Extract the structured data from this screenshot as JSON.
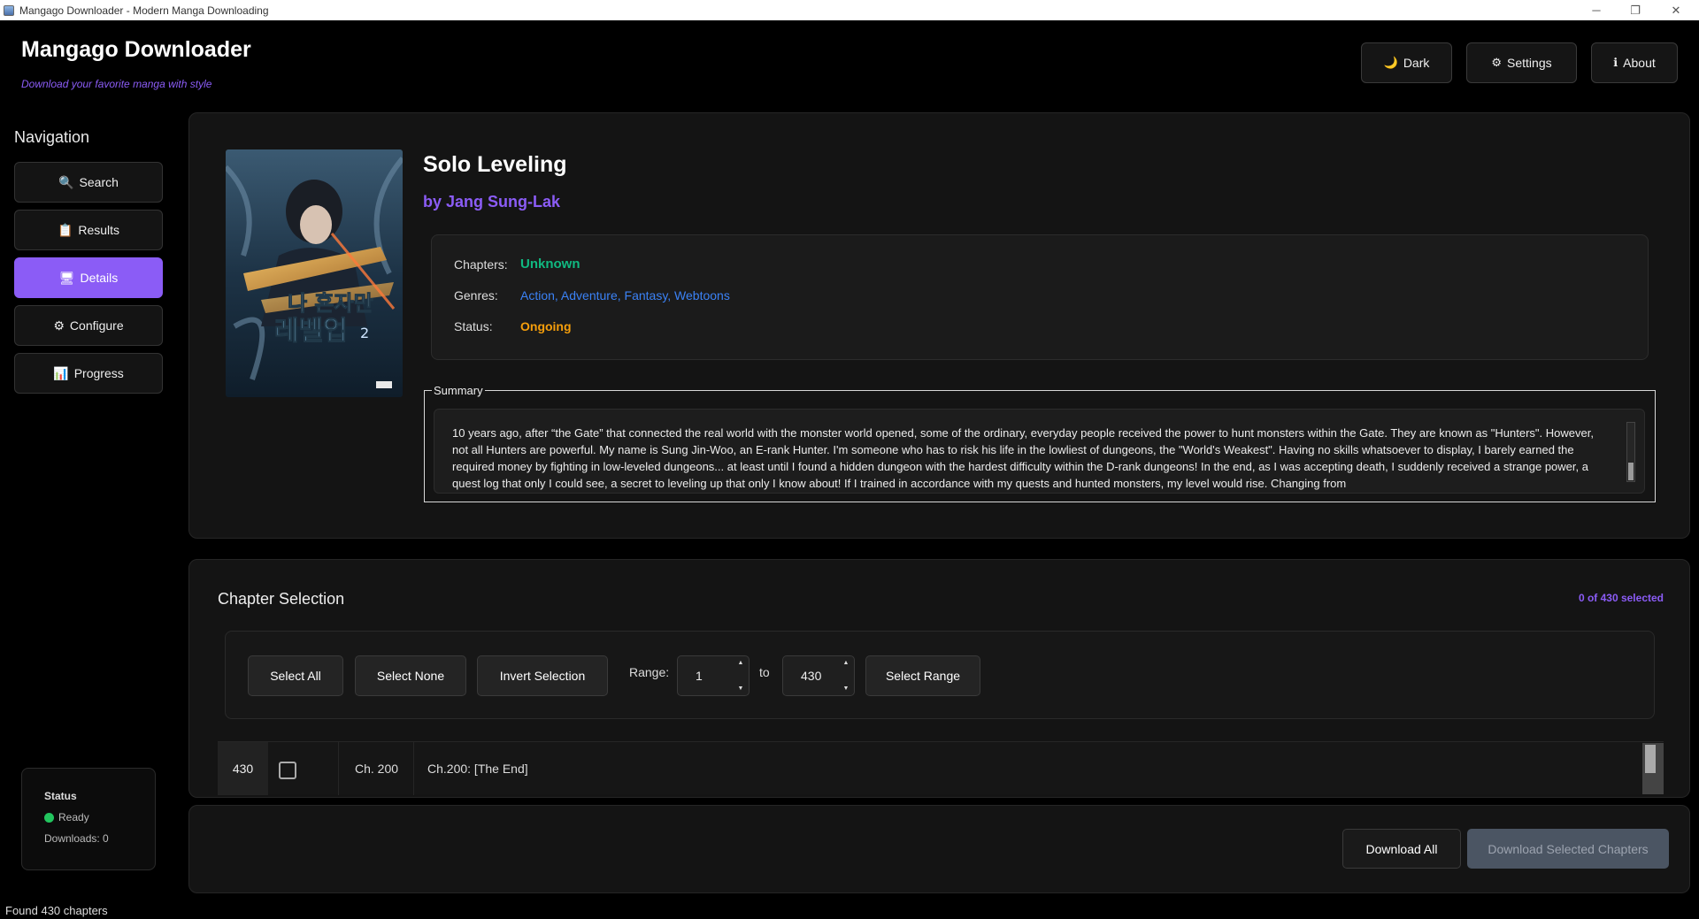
{
  "window": {
    "title": "Mangago Downloader - Modern Manga Downloading",
    "minimize": "─",
    "restore": "❐",
    "close": "✕"
  },
  "header": {
    "title": "Mangago Downloader",
    "subtitle": "Download your favorite manga with style",
    "buttons": [
      {
        "icon": "🌙",
        "label": "Dark"
      },
      {
        "icon": "⚙",
        "label": "Settings"
      },
      {
        "icon": "ℹ",
        "label": "About"
      }
    ]
  },
  "sidebar": {
    "title": "Navigation",
    "items": [
      {
        "icon": "🔍",
        "label": "Search"
      },
      {
        "icon": "📋",
        "label": "Results"
      },
      {
        "icon": "🖥",
        "label": "Details",
        "active": true
      },
      {
        "icon": "⚙",
        "label": "Configure"
      },
      {
        "icon": "📊",
        "label": "Progress"
      }
    ],
    "status": {
      "title": "Status",
      "state": "Ready",
      "downloads": "Downloads: 0"
    }
  },
  "details": {
    "cover_label": "나 혼자만 레벨업 2",
    "title": "Solo Leveling",
    "author": "by Jang Sung-Lak",
    "chapters_label": "Chapters:",
    "chapters_value": "Unknown",
    "genres_label": "Genres:",
    "genres_value": "Action, Adventure, Fantasy, Webtoons",
    "status_label": "Status:",
    "status_value": "Ongoing",
    "summary_legend": "Summary",
    "summary_text": "10 years ago, after “the Gate” that connected the real world with the monster world opened, some of the ordinary, everyday people received the power to hunt monsters within the Gate. They are known as \"Hunters\". However, not all Hunters are powerful. My name is Sung Jin-Woo, an E-rank Hunter. I'm someone who has to risk his life in the lowliest of dungeons, the \"World's Weakest\". Having no skills whatsoever to display, I barely earned the required money by fighting in low-leveled dungeons... at least until I found a hidden dungeon with the hardest difficulty within the D-rank dungeons! In the end, as I was accepting death, I suddenly received a strange power, a quest log that only I could see, a secret to leveling up that only I know about! If I trained in accordance with my quests and hunted monsters, my level would rise. Changing from"
  },
  "chapter_selection": {
    "title": "Chapter Selection",
    "selected_count": "0 of 430 selected",
    "select_all": "Select All",
    "select_none": "Select None",
    "invert": "Invert Selection",
    "range_label": "Range:",
    "range_from": "1",
    "to_label": "to",
    "range_to": "430",
    "select_range": "Select Range",
    "rows": [
      {
        "number": "430",
        "short": "Ch. 200",
        "title": "Ch.200: [The End]",
        "checked": false
      }
    ]
  },
  "actions": {
    "download_all": "Download All",
    "download_selected": "Download Selected Chapters"
  },
  "footer": {
    "status": "Found 430 chapters"
  },
  "colors": {
    "accent": "#8b5cf6",
    "success": "#10b981",
    "link": "#3b82f6",
    "warning": "#f59e0b",
    "ready_dot": "#22c55e"
  }
}
